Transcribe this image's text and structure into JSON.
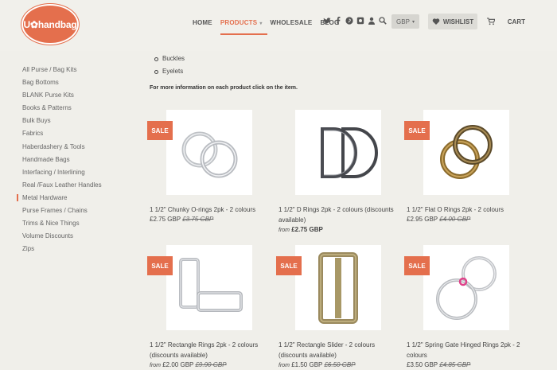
{
  "header": {
    "logo_text": "U✿handbag",
    "nav": [
      "HOME",
      "PRODUCTS",
      "WHOLESALE",
      "BLOG"
    ],
    "active_nav": "PRODUCTS",
    "currency": "GBP",
    "wishlist_label": "WISHLIST",
    "cart_label": "CART"
  },
  "sidebar": {
    "items": [
      "All Purse / Bag Kits",
      "Bag Bottoms",
      "BLANK Purse Kits",
      "Books & Patterns",
      "Bulk Buys",
      "Fabrics",
      "Haberdashery & Tools",
      "Handmade Bags",
      "Interfacing / Interlining",
      "Real /Faux Leather Handles",
      "Metal Hardware",
      "Purse Frames / Chains",
      "Trims & Nice Things",
      "Volume Discounts",
      "Zips"
    ],
    "active": "Metal Hardware"
  },
  "content": {
    "bullets": [
      "Buckles",
      "Eyelets"
    ],
    "info": "For more information on each product click on the item."
  },
  "products": [
    {
      "title": "1 1/2\" Chunky O-rings 2pk - 2 colours",
      "sale": true,
      "from": "",
      "price": "£2.75 GBP",
      "old_price": "£3.75 GBP",
      "image": "o-rings"
    },
    {
      "title": "1 1/2\" D Rings 2pk - 2 colours (discounts available)",
      "sale": false,
      "from": "from",
      "price": "£2.75 GBP",
      "old_price": "",
      "image": "d-rings"
    },
    {
      "title": "1 1/2\" Flat O Rings 2pk - 2 colours",
      "sale": true,
      "from": "",
      "price": "£2.95 GBP",
      "old_price": "£4.00 GBP",
      "image": "flat-o-rings"
    },
    {
      "title": "1 1/2\" Rectangle Rings 2pk - 2 colours (discounts available)",
      "sale": true,
      "from": "from",
      "price": "£2.00 GBP",
      "old_price": "£9.90 GBP",
      "image": "rectangle-rings"
    },
    {
      "title": "1 1/2\" Rectangle Slider - 2 colours (discounts available)",
      "sale": true,
      "from": "from",
      "price": "£1.50 GBP",
      "old_price": "£6.50 GBP",
      "image": "slider"
    },
    {
      "title": "1 1/2\" Spring Gate Hinged Rings 2pk - 2 colours",
      "sale": true,
      "from": "",
      "price": "£3.50 GBP",
      "old_price": "£4.85 GBP",
      "image": "spring-rings"
    }
  ],
  "sale_label": "SALE",
  "colors": {
    "accent": "#e46f4d",
    "background": "#f0efea"
  }
}
